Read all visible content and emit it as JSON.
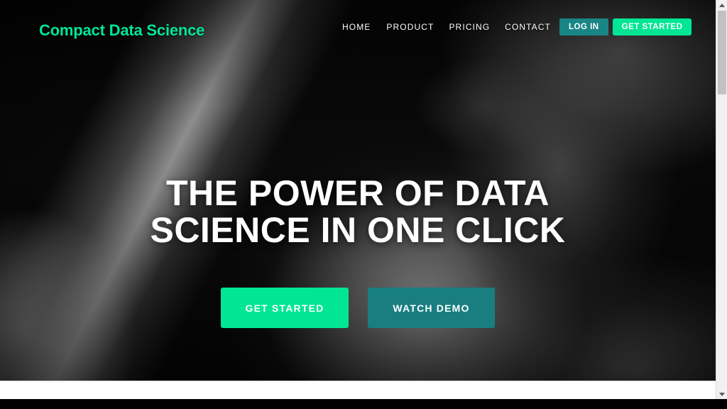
{
  "site": {
    "logo_text": "Compact Data Science",
    "brand_green": "#00E695",
    "brand_teal": "#1A8585",
    "cta_teal": "#187E80"
  },
  "header": {
    "nav_links": [
      {
        "label": "HOME"
      },
      {
        "label": "PRODUCT"
      },
      {
        "label": "PRICING"
      },
      {
        "label": "CONTACT"
      }
    ],
    "login_label": "LOG IN",
    "get_started_label": "GET STARTED"
  },
  "hero": {
    "headline_line1": "THE POWER OF DATA",
    "headline_line2": "SCIENCE IN ONE CLICK",
    "cta_primary_label": "GET STARTED",
    "cta_secondary_label": "WATCH DEMO"
  },
  "scrollbar": {
    "up_arrow_icon": "chevron-up-icon",
    "down_arrow_icon": "chevron-down-icon"
  }
}
